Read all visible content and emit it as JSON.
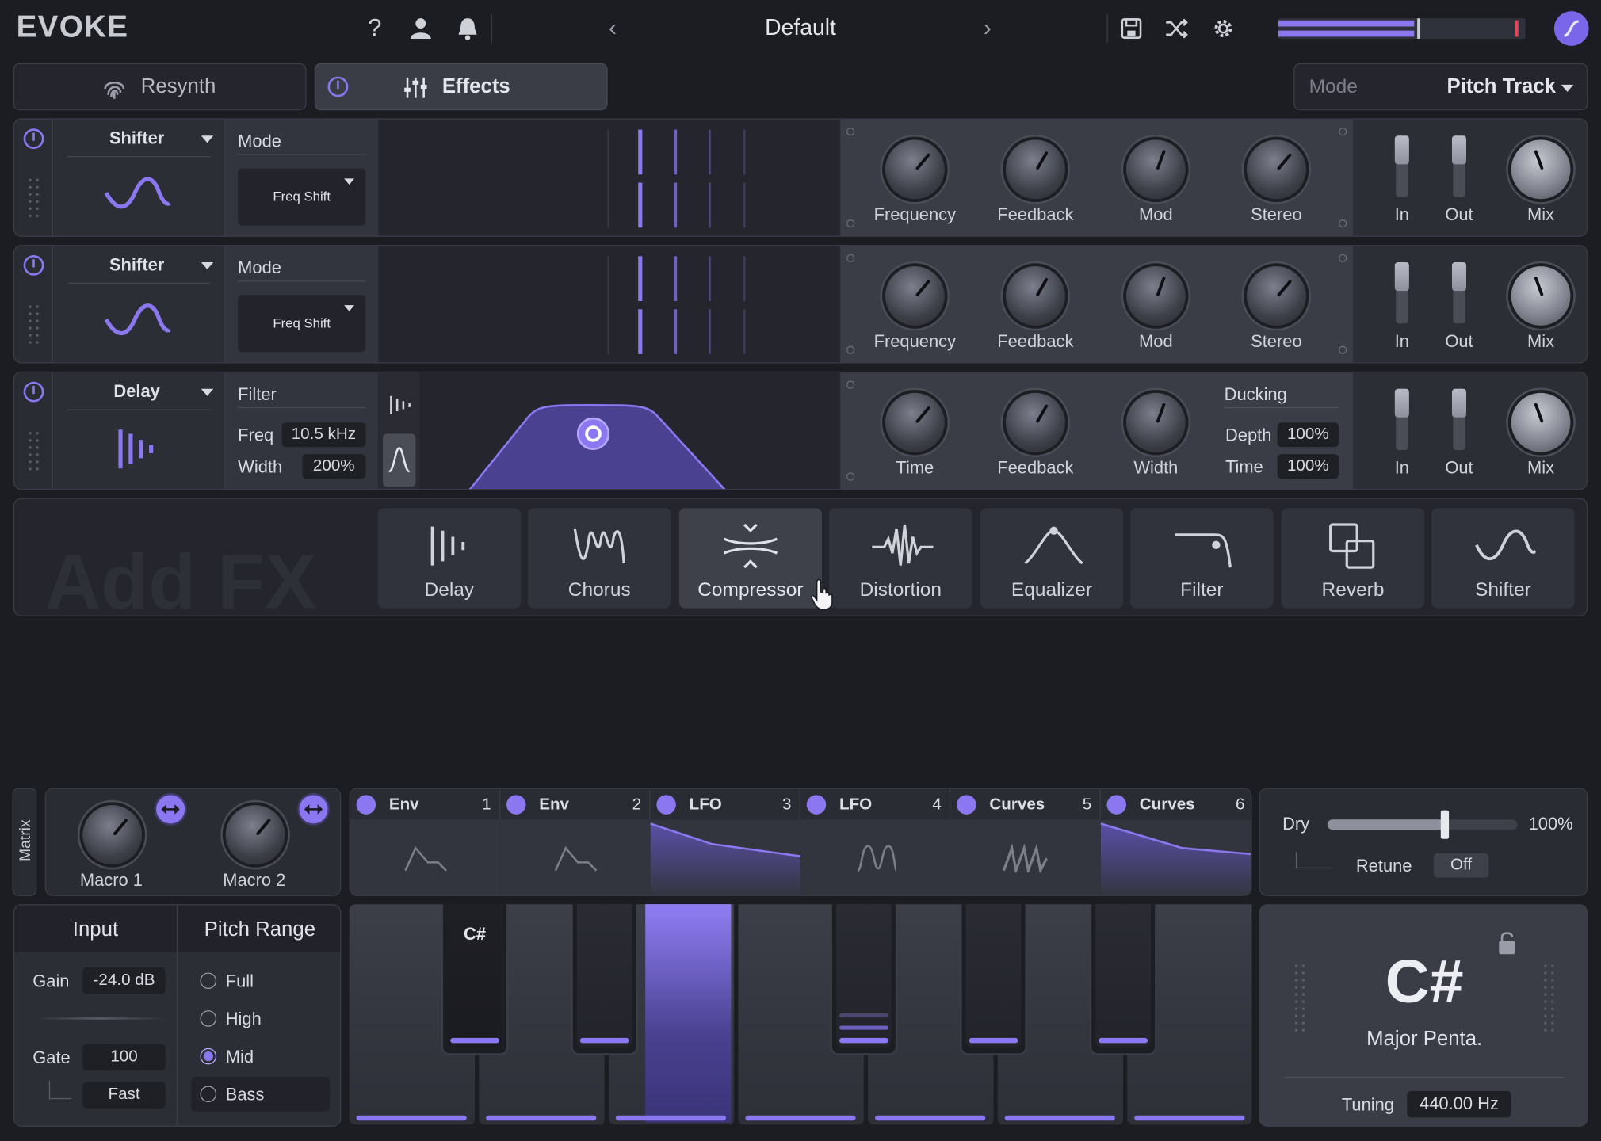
{
  "header": {
    "logo": "EVOKE",
    "preset": "Default",
    "meter_level": 0.55,
    "meter_peak": 0.96
  },
  "tabs": {
    "resynth": "Resynth",
    "effects": "Effects",
    "mode_label": "Mode",
    "mode_value": "Pitch Track"
  },
  "slots": [
    {
      "type": "Shifter",
      "section_label": "Mode",
      "mode_value": "Freq Shift",
      "knobs": [
        "Frequency",
        "Feedback",
        "Mod",
        "Stereo"
      ],
      "io": [
        "In",
        "Out",
        "Mix"
      ]
    },
    {
      "type": "Shifter",
      "section_label": "Mode",
      "mode_value": "Freq Shift",
      "knobs": [
        "Frequency",
        "Feedback",
        "Mod",
        "Stereo"
      ],
      "io": [
        "In",
        "Out",
        "Mix"
      ]
    },
    {
      "type": "Delay",
      "section_label": "Filter",
      "freq_label": "Freq",
      "freq_value": "10.5 kHz",
      "width_label": "Width",
      "width_value": "200%",
      "knobs": [
        "Time",
        "Feedback",
        "Width"
      ],
      "ducking_label": "Ducking",
      "depth_label": "Depth",
      "depth_value": "100%",
      "time_label": "Time",
      "time_value": "100%",
      "io": [
        "In",
        "Out",
        "Mix"
      ]
    }
  ],
  "add_fx": {
    "watermark": "Add FX",
    "items": [
      "Delay",
      "Chorus",
      "Compressor",
      "Distortion",
      "Equalizer",
      "Filter",
      "Reverb",
      "Shifter"
    ]
  },
  "matrix": {
    "label": "Matrix",
    "macros": [
      "Macro 1",
      "Macro 2"
    ]
  },
  "modulators": [
    {
      "name": "Env",
      "num": "1"
    },
    {
      "name": "Env",
      "num": "2"
    },
    {
      "name": "LFO",
      "num": "3"
    },
    {
      "name": "LFO",
      "num": "4"
    },
    {
      "name": "Curves",
      "num": "5"
    },
    {
      "name": "Curves",
      "num": "6"
    }
  ],
  "output": {
    "dry_label": "Dry",
    "dry_value": "100%",
    "dry_level": 0.62,
    "retune_label": "Retune",
    "retune_value": "Off"
  },
  "input": {
    "title": "Input",
    "gain_label": "Gain",
    "gain_value": "-24.0 dB",
    "gate_label": "Gate",
    "gate_value": "100",
    "speed_value": "Fast"
  },
  "pitch_range": {
    "title": "Pitch Range",
    "options": [
      "Full",
      "High",
      "Mid",
      "Bass"
    ],
    "selected": "Mid"
  },
  "keyboard": {
    "highlight_label": "C#"
  },
  "scale": {
    "key": "C#",
    "scale": "Major Penta.",
    "tuning_label": "Tuning",
    "tuning_value": "440.00 Hz"
  }
}
